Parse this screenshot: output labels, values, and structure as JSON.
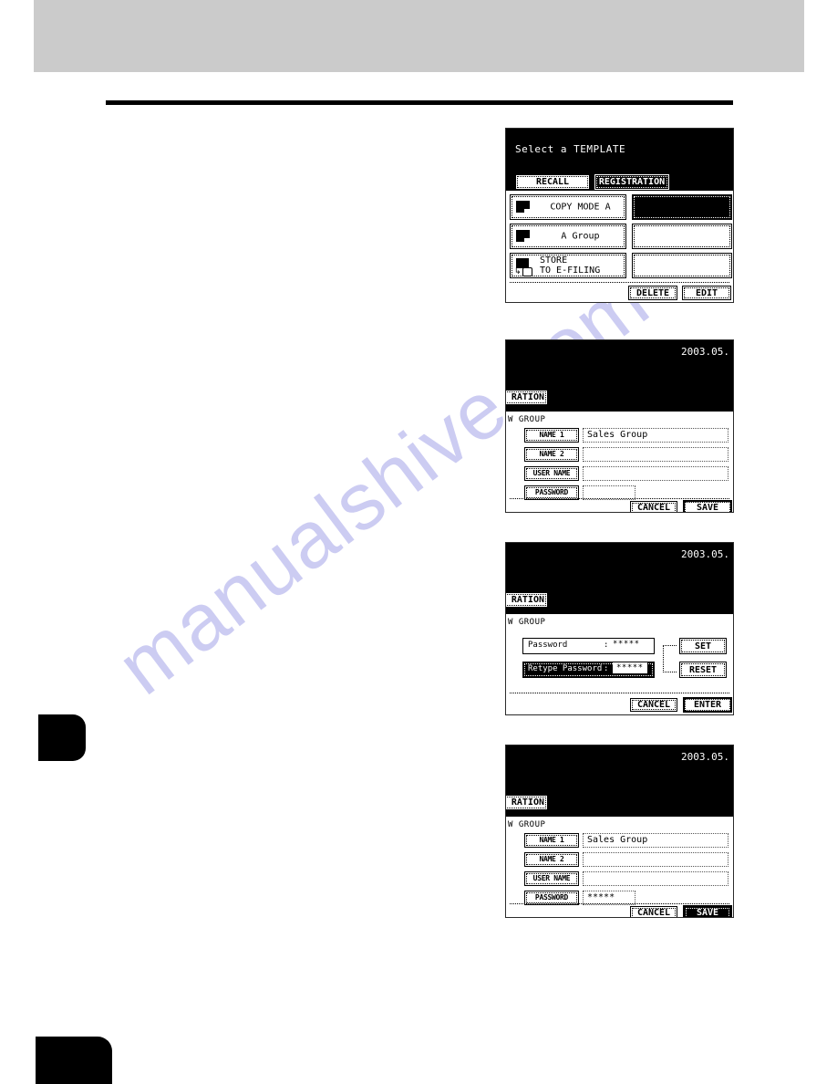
{
  "page": {
    "watermark": "manualshive.com"
  },
  "panels": [
    {
      "id": "select-template",
      "title": "Select a TEMPLATE",
      "tabs": [
        {
          "label": "RECALL",
          "selected": false
        },
        {
          "label": "REGISTRATION",
          "selected": true
        }
      ],
      "templates": [
        {
          "label": "COPY MODE A",
          "icon": "document-icon",
          "slot_filled": true
        },
        {
          "label": "A Group",
          "icon": "document-icon",
          "slot_filled": false
        },
        {
          "label": "STORE\nTO E-FILING",
          "icon": "document-efiling-icon",
          "slot_filled": false
        }
      ],
      "buttons": [
        {
          "label": "DELETE",
          "inverted": false
        },
        {
          "label": "EDIT",
          "inverted": false
        }
      ]
    },
    {
      "id": "new-group-name",
      "date": "2003.05.",
      "tab_label": "RATION",
      "subtitle": "W GROUP",
      "fields": [
        {
          "label": "NAME 1",
          "value": "Sales Group"
        },
        {
          "label": "NAME 2",
          "value": ""
        },
        {
          "label": "USER NAME",
          "value": ""
        },
        {
          "label": "PASSWORD",
          "value": ""
        }
      ],
      "buttons": [
        {
          "label": "CANCEL",
          "inverted": false
        },
        {
          "label": "SAVE",
          "inverted": false
        }
      ]
    },
    {
      "id": "new-group-password",
      "date": "2003.05.",
      "tab_label": "RATION",
      "subtitle": "W GROUP",
      "password_rows": [
        {
          "label": "Password",
          "separator": ":",
          "value": "*****",
          "active": false
        },
        {
          "label": "Retype Password",
          "separator": ":",
          "value": "*****",
          "active": true
        }
      ],
      "side_buttons": [
        {
          "label": "SET",
          "inverted": false
        },
        {
          "label": "RESET",
          "inverted": false
        }
      ],
      "buttons": [
        {
          "label": "CANCEL",
          "inverted": false
        },
        {
          "label": "ENTER",
          "inverted": false
        }
      ]
    },
    {
      "id": "new-group-saved",
      "date": "2003.05.",
      "tab_label": "RATION",
      "subtitle": "W GROUP",
      "fields": [
        {
          "label": "NAME 1",
          "value": "Sales Group"
        },
        {
          "label": "NAME 2",
          "value": ""
        },
        {
          "label": "USER NAME",
          "value": ""
        },
        {
          "label": "PASSWORD",
          "value": "*****"
        }
      ],
      "buttons": [
        {
          "label": "CANCEL",
          "inverted": false
        },
        {
          "label": "SAVE",
          "inverted": true
        }
      ]
    }
  ]
}
